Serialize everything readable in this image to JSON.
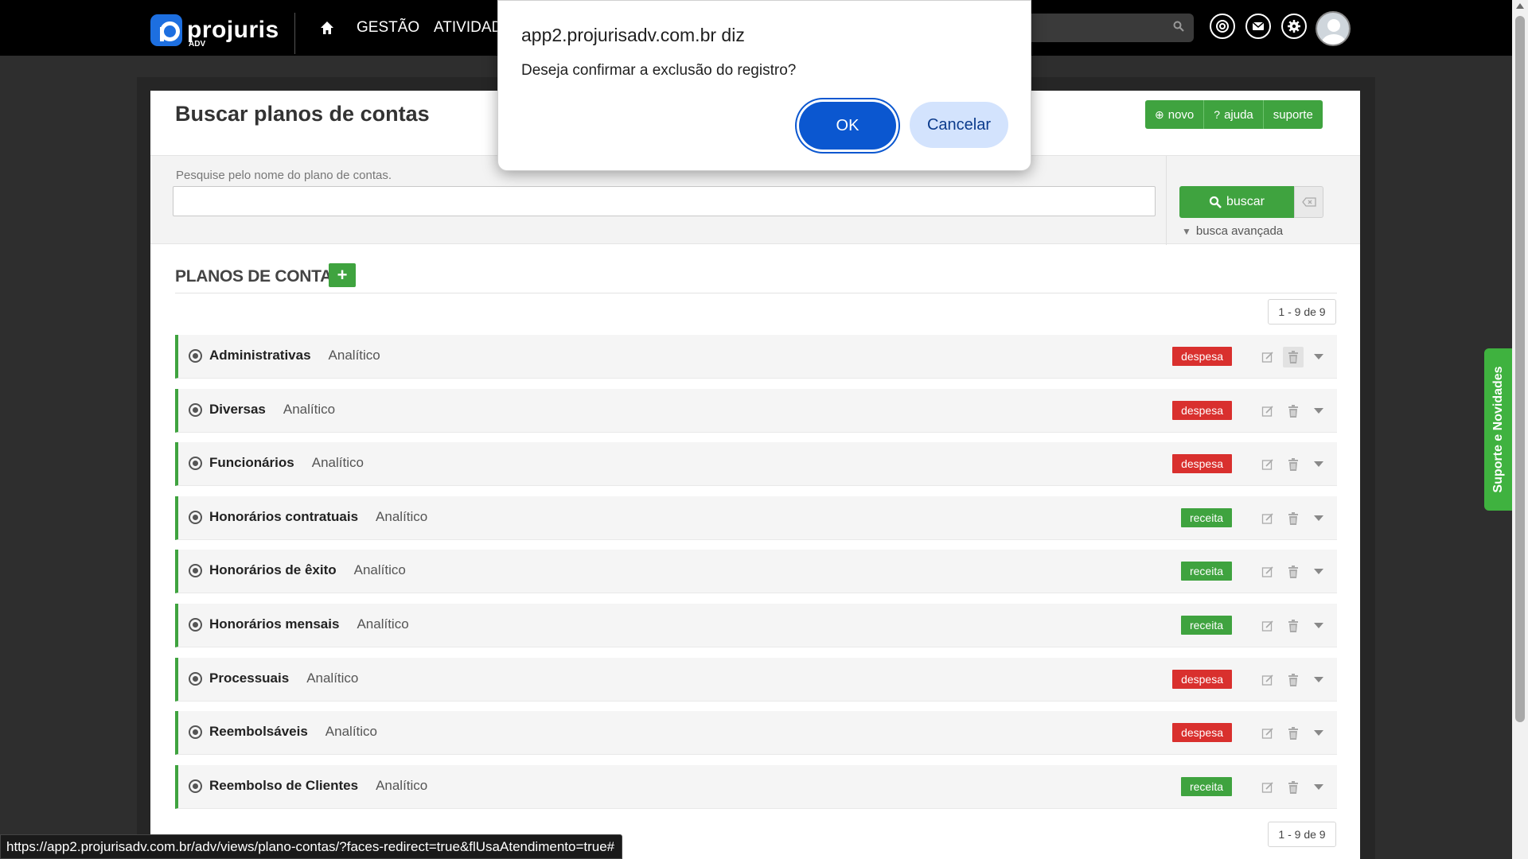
{
  "header": {
    "logo_text": "projuris",
    "logo_sub": "ADV",
    "nav": [
      "GESTÃO",
      "ATIVIDAD"
    ]
  },
  "page": {
    "title": "Buscar planos de contas",
    "buttons": {
      "novo": "novo",
      "ajuda": "ajuda",
      "suporte": "suporte"
    },
    "search_label": "Pesquise pelo nome do plano de contas.",
    "search_value": "",
    "buscar": "buscar",
    "busca_avancada": "busca avançada",
    "section_title": "PLANOS DE CONTAS",
    "pager": "1 - 9 de 9"
  },
  "rows": [
    {
      "name": "Administrativas",
      "type": "Analítico",
      "kind": "despesa"
    },
    {
      "name": "Diversas",
      "type": "Analítico",
      "kind": "despesa"
    },
    {
      "name": "Funcionários",
      "type": "Analítico",
      "kind": "despesa"
    },
    {
      "name": "Honorários contratuais",
      "type": "Analítico",
      "kind": "receita"
    },
    {
      "name": "Honorários de êxito",
      "type": "Analítico",
      "kind": "receita"
    },
    {
      "name": "Honorários mensais",
      "type": "Analítico",
      "kind": "receita"
    },
    {
      "name": "Processuais",
      "type": "Analítico",
      "kind": "despesa"
    },
    {
      "name": "Reembolsáveis",
      "type": "Analítico",
      "kind": "despesa"
    },
    {
      "name": "Reembolso de Clientes",
      "type": "Analítico",
      "kind": "receita"
    }
  ],
  "support_tab": "Suporte e Novidades",
  "status_url": "https://app2.projurisadv.com.br/adv/views/plano-contas/?faces-redirect=true&flUsaAtendimento=true#",
  "dialog": {
    "title": "app2.projurisadv.com.br diz",
    "message": "Deseja confirmar a exclusão do registro?",
    "ok": "OK",
    "cancel": "Cancelar"
  },
  "colors": {
    "green": "#3fa33f",
    "red": "#d9302e",
    "dialog_ok": "#0b57d0"
  }
}
